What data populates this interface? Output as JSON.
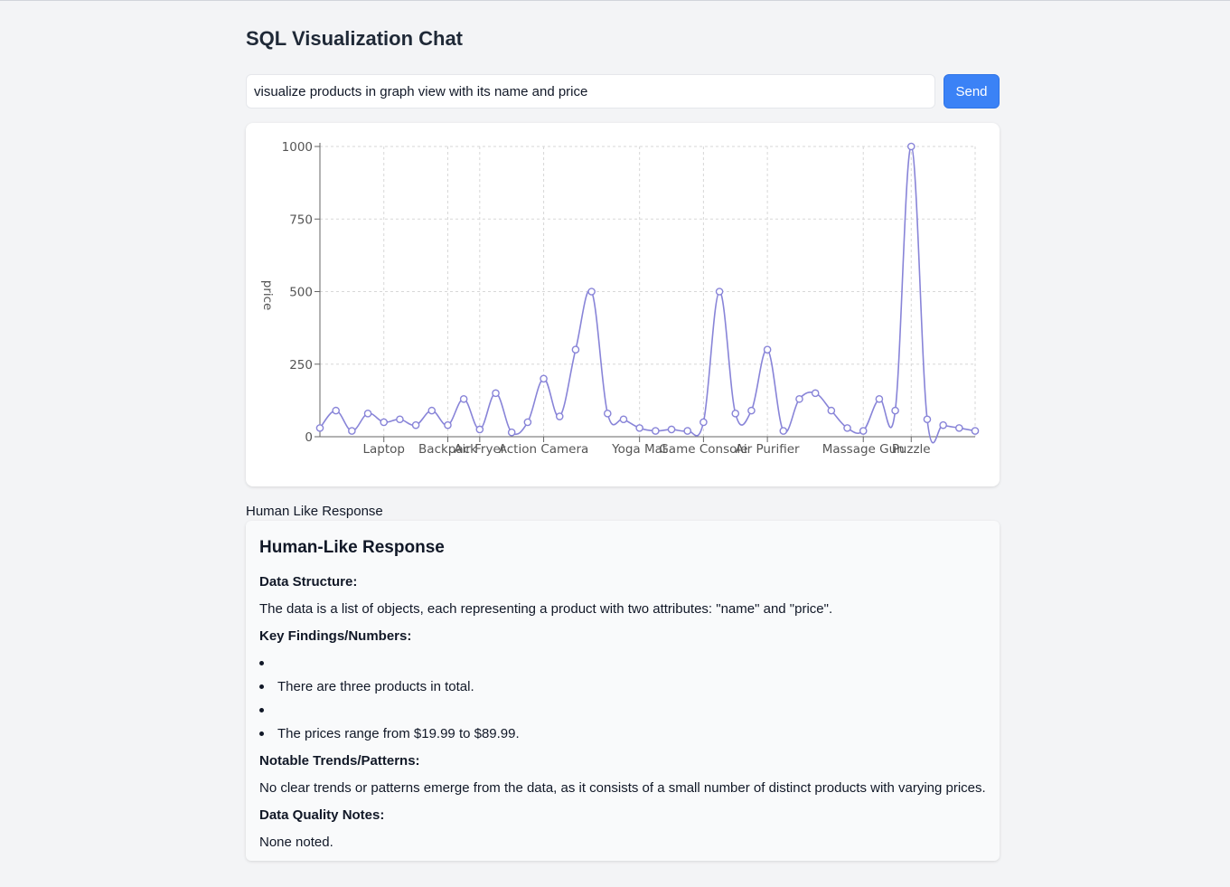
{
  "header": {
    "title": "SQL Visualization Chat"
  },
  "query": {
    "value": "visualize products in graph view with its name and price",
    "placeholder": ""
  },
  "send_label": "Send",
  "accent_color": "#3b82f6",
  "line_color": "#8884d8",
  "chart_data": {
    "type": "line",
    "title": "",
    "xlabel": "",
    "ylabel": "price",
    "ylim": [
      0,
      1000
    ],
    "yticks": [
      0,
      250,
      500,
      750,
      1000
    ],
    "grid": true,
    "categories": [
      "",
      "",
      "",
      "",
      "Laptop",
      "",
      "",
      "",
      "Backpack",
      "",
      "Air Fryer",
      "",
      "",
      "",
      "Action Camera",
      "",
      "",
      "",
      "",
      "",
      "Yoga Mat",
      "",
      "",
      "",
      "Game Console",
      "",
      "",
      "",
      "Air Purifier",
      "",
      "",
      "",
      "",
      "",
      "Massage Gun",
      "",
      "",
      "Puzzle",
      "",
      "",
      ""
    ],
    "series": [
      {
        "values": [
          30,
          90,
          20,
          80,
          50,
          60,
          40,
          90,
          40,
          130,
          25,
          150,
          15,
          50,
          200,
          70,
          300,
          500,
          80,
          60,
          30,
          20,
          25,
          20,
          50,
          500,
          80,
          90,
          300,
          20,
          130,
          150,
          90,
          30,
          20,
          130,
          90,
          1000,
          60,
          40,
          30,
          20
        ]
      }
    ],
    "x_labels_shown": [
      "Laptop",
      "Backpack",
      "Air Fryer",
      "Action Camera",
      "Yoga Mat",
      "Game Console",
      "Air Purifier",
      "Massage Gun",
      "Puzzle"
    ]
  },
  "section_label": "Human Like Response",
  "response": {
    "title": "Human-Like Response",
    "data_structure_heading": "Data Structure:",
    "data_structure_text": "The data is a list of objects, each representing a product with two attributes: \"name\" and \"price\".",
    "key_findings_heading": "Key Findings/Numbers:",
    "key_findings": [
      "",
      "There are three products in total.",
      "",
      "The prices range from $19.99 to $89.99."
    ],
    "trends_heading": "Notable Trends/Patterns:",
    "trends_text": "No clear trends or patterns emerge from the data, as it consists of a small number of distinct products with varying prices.",
    "quality_heading": "Data Quality Notes:",
    "quality_text": "None noted."
  }
}
